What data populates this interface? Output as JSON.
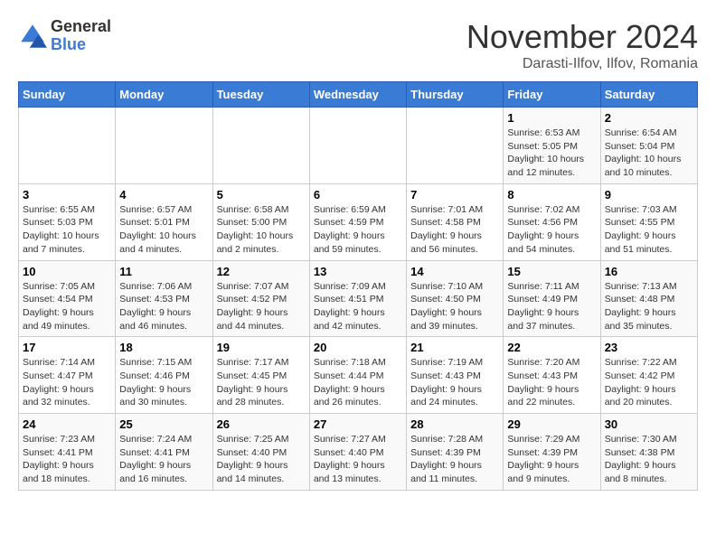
{
  "header": {
    "logo_general": "General",
    "logo_blue": "Blue",
    "month_year": "November 2024",
    "location": "Darasti-Ilfov, Ilfov, Romania"
  },
  "weekdays": [
    "Sunday",
    "Monday",
    "Tuesday",
    "Wednesday",
    "Thursday",
    "Friday",
    "Saturday"
  ],
  "weeks": [
    [
      {
        "day": "",
        "info": ""
      },
      {
        "day": "",
        "info": ""
      },
      {
        "day": "",
        "info": ""
      },
      {
        "day": "",
        "info": ""
      },
      {
        "day": "",
        "info": ""
      },
      {
        "day": "1",
        "info": "Sunrise: 6:53 AM\nSunset: 5:05 PM\nDaylight: 10 hours and 12 minutes."
      },
      {
        "day": "2",
        "info": "Sunrise: 6:54 AM\nSunset: 5:04 PM\nDaylight: 10 hours and 10 minutes."
      }
    ],
    [
      {
        "day": "3",
        "info": "Sunrise: 6:55 AM\nSunset: 5:03 PM\nDaylight: 10 hours and 7 minutes."
      },
      {
        "day": "4",
        "info": "Sunrise: 6:57 AM\nSunset: 5:01 PM\nDaylight: 10 hours and 4 minutes."
      },
      {
        "day": "5",
        "info": "Sunrise: 6:58 AM\nSunset: 5:00 PM\nDaylight: 10 hours and 2 minutes."
      },
      {
        "day": "6",
        "info": "Sunrise: 6:59 AM\nSunset: 4:59 PM\nDaylight: 9 hours and 59 minutes."
      },
      {
        "day": "7",
        "info": "Sunrise: 7:01 AM\nSunset: 4:58 PM\nDaylight: 9 hours and 56 minutes."
      },
      {
        "day": "8",
        "info": "Sunrise: 7:02 AM\nSunset: 4:56 PM\nDaylight: 9 hours and 54 minutes."
      },
      {
        "day": "9",
        "info": "Sunrise: 7:03 AM\nSunset: 4:55 PM\nDaylight: 9 hours and 51 minutes."
      }
    ],
    [
      {
        "day": "10",
        "info": "Sunrise: 7:05 AM\nSunset: 4:54 PM\nDaylight: 9 hours and 49 minutes."
      },
      {
        "day": "11",
        "info": "Sunrise: 7:06 AM\nSunset: 4:53 PM\nDaylight: 9 hours and 46 minutes."
      },
      {
        "day": "12",
        "info": "Sunrise: 7:07 AM\nSunset: 4:52 PM\nDaylight: 9 hours and 44 minutes."
      },
      {
        "day": "13",
        "info": "Sunrise: 7:09 AM\nSunset: 4:51 PM\nDaylight: 9 hours and 42 minutes."
      },
      {
        "day": "14",
        "info": "Sunrise: 7:10 AM\nSunset: 4:50 PM\nDaylight: 9 hours and 39 minutes."
      },
      {
        "day": "15",
        "info": "Sunrise: 7:11 AM\nSunset: 4:49 PM\nDaylight: 9 hours and 37 minutes."
      },
      {
        "day": "16",
        "info": "Sunrise: 7:13 AM\nSunset: 4:48 PM\nDaylight: 9 hours and 35 minutes."
      }
    ],
    [
      {
        "day": "17",
        "info": "Sunrise: 7:14 AM\nSunset: 4:47 PM\nDaylight: 9 hours and 32 minutes."
      },
      {
        "day": "18",
        "info": "Sunrise: 7:15 AM\nSunset: 4:46 PM\nDaylight: 9 hours and 30 minutes."
      },
      {
        "day": "19",
        "info": "Sunrise: 7:17 AM\nSunset: 4:45 PM\nDaylight: 9 hours and 28 minutes."
      },
      {
        "day": "20",
        "info": "Sunrise: 7:18 AM\nSunset: 4:44 PM\nDaylight: 9 hours and 26 minutes."
      },
      {
        "day": "21",
        "info": "Sunrise: 7:19 AM\nSunset: 4:43 PM\nDaylight: 9 hours and 24 minutes."
      },
      {
        "day": "22",
        "info": "Sunrise: 7:20 AM\nSunset: 4:43 PM\nDaylight: 9 hours and 22 minutes."
      },
      {
        "day": "23",
        "info": "Sunrise: 7:22 AM\nSunset: 4:42 PM\nDaylight: 9 hours and 20 minutes."
      }
    ],
    [
      {
        "day": "24",
        "info": "Sunrise: 7:23 AM\nSunset: 4:41 PM\nDaylight: 9 hours and 18 minutes."
      },
      {
        "day": "25",
        "info": "Sunrise: 7:24 AM\nSunset: 4:41 PM\nDaylight: 9 hours and 16 minutes."
      },
      {
        "day": "26",
        "info": "Sunrise: 7:25 AM\nSunset: 4:40 PM\nDaylight: 9 hours and 14 minutes."
      },
      {
        "day": "27",
        "info": "Sunrise: 7:27 AM\nSunset: 4:40 PM\nDaylight: 9 hours and 13 minutes."
      },
      {
        "day": "28",
        "info": "Sunrise: 7:28 AM\nSunset: 4:39 PM\nDaylight: 9 hours and 11 minutes."
      },
      {
        "day": "29",
        "info": "Sunrise: 7:29 AM\nSunset: 4:39 PM\nDaylight: 9 hours and 9 minutes."
      },
      {
        "day": "30",
        "info": "Sunrise: 7:30 AM\nSunset: 4:38 PM\nDaylight: 9 hours and 8 minutes."
      }
    ]
  ]
}
